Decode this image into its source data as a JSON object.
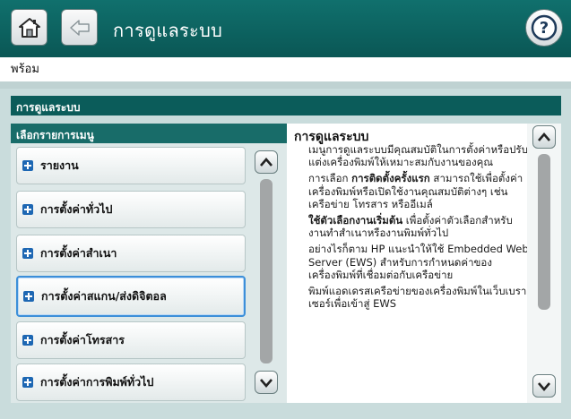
{
  "header": {
    "title": "การดูแลระบบ",
    "home_icon": "home-icon",
    "back_icon": "back-arrow-icon",
    "help_icon": "help-question-icon"
  },
  "status": {
    "text": "พร้อม"
  },
  "panel": {
    "title": "การดูแลระบบ"
  },
  "menu": {
    "header": "เลือกรายการเมนู",
    "items": [
      {
        "label": "รายงาน"
      },
      {
        "label": "การตั้งค่าทั่วไป"
      },
      {
        "label": "การตั้งค่าสำเนา"
      },
      {
        "label": "การตั้งค่าสแกน/ส่งดิจิตอล"
      },
      {
        "label": "การตั้งค่าโทรสาร"
      },
      {
        "label": "การตั้งค่าการพิมพ์ทั่วไป"
      }
    ],
    "selected_index": 3
  },
  "description": {
    "title": "การดูแลระบบ",
    "p1": "เมนูการดูแลระบบมีคุณสมบัติในการตั้งค่าหรือปรับแต่งเครื่องพิมพ์ให้เหมาะสมกับงานของคุณ",
    "p2_prefix": "การเลือก ",
    "p2_bold": "การติดตั้งครั้งแรก",
    "p2_suffix": " สามารถใช้เพื่อตั้งค่าเครื่องพิมพ์หรือเปิดใช้งานคุณสมบัติต่างๆ เช่น เครือข่าย โทรสาร หรืออีเมล์",
    "p3_prefix": "ใช้",
    "p3_bold": "ตัวเลือกงานเริ่มต้น",
    "p3_suffix": " เพื่อตั้งค่าตัวเลือกสำหรับงานทำสำเนาหรืองานพิมพ์ทั่วไป",
    "p4": "อย่างไรก็ตาม HP แนะนำให้ใช้ Embedded Web Server (EWS) สำหรับการกำหนดค่าของเครื่องพิมพ์ที่เชื่อมต่อกับเครือข่าย",
    "p5": "พิมพ์แอดเดรสเครือข่ายของเครื่องพิมพ์ในเว็บเบราเซอร์เพื่อเข้าสู่ EWS"
  },
  "colors": {
    "header_bg": "#0a5755",
    "panel_bg": "#c9dcdc",
    "selection_border": "#3c8fd9",
    "plus_icon": "#1d67b3"
  }
}
